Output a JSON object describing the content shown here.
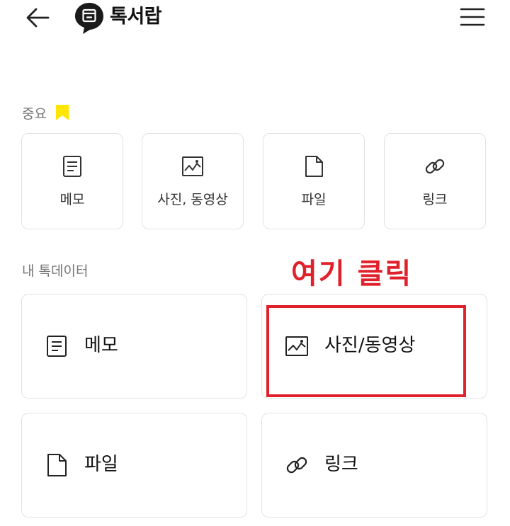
{
  "header": {
    "title": "톡서랍"
  },
  "important": {
    "label": "중요",
    "items": [
      {
        "label": "메모",
        "icon": "memo-icon"
      },
      {
        "label": "사진, 동영상",
        "icon": "image-icon"
      },
      {
        "label": "파일",
        "icon": "file-icon"
      },
      {
        "label": "링크",
        "icon": "link-icon"
      }
    ]
  },
  "my_data": {
    "label": "내 톡데이터",
    "items": [
      {
        "label": "메모",
        "icon": "memo-icon"
      },
      {
        "label": "사진/동영상",
        "icon": "image-icon"
      },
      {
        "label": "파일",
        "icon": "file-icon"
      },
      {
        "label": "링크",
        "icon": "link-icon"
      }
    ]
  },
  "annotation": {
    "text": "여기 클릭",
    "color": "#e0212b"
  },
  "colors": {
    "accent_yellow": "#ffe600",
    "card_border": "#e2e2e2",
    "muted_text": "#777777"
  }
}
